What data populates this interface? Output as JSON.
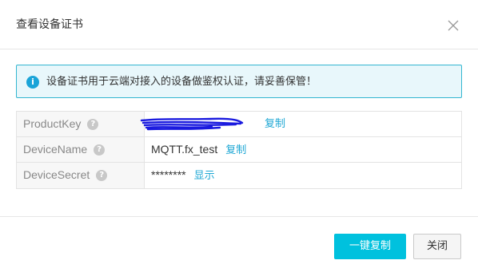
{
  "dialog": {
    "title": "查看设备证书"
  },
  "alert": {
    "icon": "i",
    "message": "设备证书用于云端对接入的设备做鉴权认证，请妥善保管！"
  },
  "rows": [
    {
      "key": "ProductKey",
      "value": "",
      "action": "复制"
    },
    {
      "key": "DeviceName",
      "value": "MQTT.fx_test",
      "action": "复制"
    },
    {
      "key": "DeviceSecret",
      "value": "********",
      "action": "显示"
    }
  ],
  "help_glyph": "?",
  "footer": {
    "copy_all": "一键复制",
    "close": "关闭"
  },
  "colors": {
    "accent": "#00c1de",
    "link": "#1ea7d4",
    "alert_border": "#33b6d1",
    "alert_bg": "#e8f7fb",
    "redaction": "#1a1adf"
  }
}
